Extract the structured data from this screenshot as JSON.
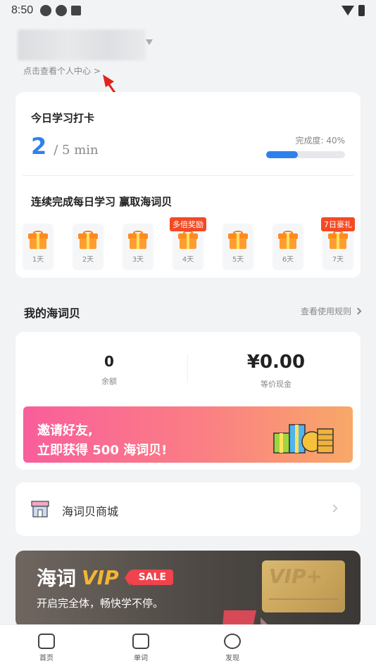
{
  "status_bar": {
    "time": "8:50"
  },
  "profile": {
    "link_text": "点击查看个人中心 >"
  },
  "daily_card": {
    "title": "今日学习打卡",
    "minutes_done": "2",
    "minutes_goal": "/ 5 min",
    "completion_label": "完成度: 40%",
    "completion_fraction": 0.4,
    "streak_title": "连续完成每日学习 赢取海词贝",
    "days": [
      {
        "label": "1天",
        "badge": ""
      },
      {
        "label": "2天",
        "badge": ""
      },
      {
        "label": "3天",
        "badge": ""
      },
      {
        "label": "4天",
        "badge": "多倍奖励"
      },
      {
        "label": "5天",
        "badge": ""
      },
      {
        "label": "6天",
        "badge": ""
      },
      {
        "label": "7天",
        "badge": "7日豪礼"
      }
    ]
  },
  "wallet": {
    "section_title": "我的海词贝",
    "rules_link": "查看使用规则",
    "balance_value": "0",
    "balance_label": "余额",
    "cash_value": "¥0.00",
    "cash_label": "等价现金",
    "invite_line1": "邀请好友,",
    "invite_line2": "立即获得 500 海词贝!"
  },
  "shop": {
    "label": "海词贝商城"
  },
  "vip": {
    "title_cn": "海词",
    "title_vip": "VIP",
    "sale_badge": "SALE",
    "subtitle": "开启完全体，畅快学不停。",
    "card_text": "VIP+"
  },
  "tabbar": {
    "items": [
      {
        "label": "首页",
        "icon": "home-icon"
      },
      {
        "label": "单词",
        "icon": "word-card-icon"
      },
      {
        "label": "发现",
        "icon": "discover-planet-icon"
      }
    ]
  },
  "colors": {
    "accent_blue": "#2f80ed",
    "badge_red": "#f44a24",
    "gift_orange": "#ff9d33",
    "vip_gold": "#f3b533"
  }
}
